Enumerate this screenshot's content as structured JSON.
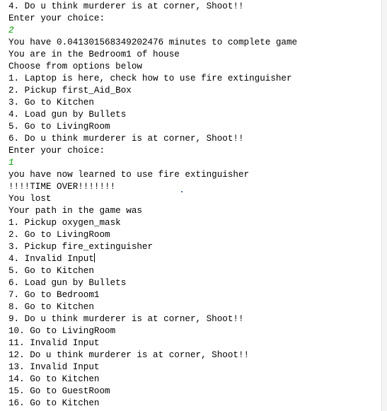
{
  "console": {
    "lines": [
      {
        "text": "4. Do u think murderer is at corner, Shoot!!",
        "kind": "output"
      },
      {
        "text": "Enter your choice:",
        "kind": "output"
      },
      {
        "text": "2",
        "kind": "input"
      },
      {
        "text": "You have 0.041301568349202476 minutes to complete game",
        "kind": "output"
      },
      {
        "text": "You are in the Bedroom1 of house",
        "kind": "output"
      },
      {
        "text": "Choose from options below",
        "kind": "output"
      },
      {
        "text": "1. Laptop is here, check how to use fire extinguisher",
        "kind": "output"
      },
      {
        "text": "2. Pickup first_Aid_Box",
        "kind": "output"
      },
      {
        "text": "3. Go to Kitchen",
        "kind": "output"
      },
      {
        "text": "4. Load gun by Bullets",
        "kind": "output"
      },
      {
        "text": "5. Go to LivingRoom",
        "kind": "output"
      },
      {
        "text": "6. Do u think murderer is at corner, Shoot!!",
        "kind": "output"
      },
      {
        "text": "Enter your choice:",
        "kind": "output"
      },
      {
        "text": "1",
        "kind": "input"
      },
      {
        "text": "you have now learned to use fire extinguisher",
        "kind": "output"
      },
      {
        "text": "!!!!TIME OVER!!!!!!!",
        "kind": "output"
      },
      {
        "text": "You lost",
        "kind": "output"
      },
      {
        "text": "Your path in the game was",
        "kind": "output"
      },
      {
        "text": "1. Pickup oxygen_mask",
        "kind": "output"
      },
      {
        "text": "2. Go to LivingRoom",
        "kind": "output"
      },
      {
        "text": "3. Pickup fire_extinguisher",
        "kind": "output"
      },
      {
        "text": "4. Invalid Input",
        "kind": "output",
        "caret": true
      },
      {
        "text": "5. Go to Kitchen",
        "kind": "output"
      },
      {
        "text": "6. Load gun by Bullets",
        "kind": "output"
      },
      {
        "text": "7. Go to Bedroom1",
        "kind": "output"
      },
      {
        "text": "8. Go to Kitchen",
        "kind": "output"
      },
      {
        "text": "9. Do u think murderer is at corner, Shoot!!",
        "kind": "output"
      },
      {
        "text": "10. Go to LivingRoom",
        "kind": "output"
      },
      {
        "text": "11. Invalid Input",
        "kind": "output"
      },
      {
        "text": "12. Do u think murderer is at corner, Shoot!!",
        "kind": "output"
      },
      {
        "text": "13. Invalid Input",
        "kind": "output"
      },
      {
        "text": "14. Go to Kitchen",
        "kind": "output"
      },
      {
        "text": "15. Go to GuestRoom",
        "kind": "output"
      },
      {
        "text": "16. Go to Kitchen",
        "kind": "output"
      }
    ]
  },
  "colors": {
    "background": "#ffffff",
    "output_text": "#000000",
    "input_text": "#009900"
  }
}
